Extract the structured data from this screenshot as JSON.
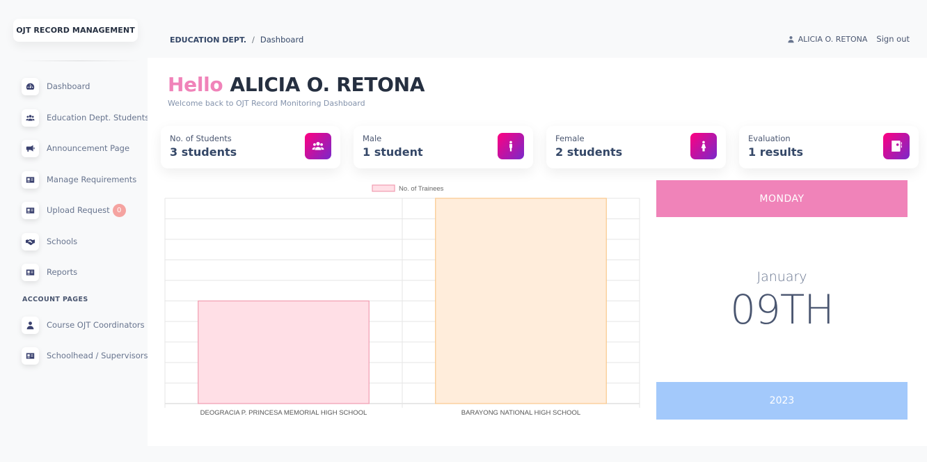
{
  "sidebar": {
    "brand": "OJT RECORD MANAGEMENT",
    "items": [
      {
        "label": "Dashboard",
        "icon": "dashboard-icon"
      },
      {
        "label": "Education Dept. Students",
        "icon": "users-icon"
      },
      {
        "label": "Announcement Page",
        "icon": "megaphone-icon"
      },
      {
        "label": "Manage Requirements",
        "icon": "id-card-icon"
      },
      {
        "label": "Upload Request",
        "icon": "id-card-icon",
        "badge": "0"
      },
      {
        "label": "Schools",
        "icon": "handshake-icon"
      },
      {
        "label": "Reports",
        "icon": "id-card-icon"
      }
    ],
    "section_title": "ACCOUNT PAGES",
    "account_items": [
      {
        "label": "Course OJT Coordinators",
        "icon": "user-icon"
      },
      {
        "label": "Schoolhead / Supervisors",
        "icon": "id-card-icon"
      }
    ]
  },
  "topbar": {
    "breadcrumb_parent": "EDUCATION DEPT.",
    "breadcrumb_sep": "/",
    "breadcrumb_current": "Dashboard",
    "user_name": "ALICIA O. RETONA",
    "signout": "Sign out"
  },
  "header": {
    "hello": "Hello",
    "name": "ALICIA O. RETONA",
    "subtitle": "Welcome back to OJT Record Monitoring Dashboard"
  },
  "stats": [
    {
      "label": "No. of Students",
      "value": "3 students",
      "icon": "users-icon"
    },
    {
      "label": "Male",
      "value": "1 student",
      "icon": "male-icon"
    },
    {
      "label": "Female",
      "value": "2 students",
      "icon": "female-icon"
    },
    {
      "label": "Evaluation",
      "value": "1 results",
      "icon": "report-card-icon"
    }
  ],
  "calendar": {
    "day": "MONDAY",
    "month": "January",
    "date": "09TH",
    "year": "2023"
  },
  "colors": {
    "accent_pink": "#f083b9",
    "accent_blue": "#a3c9fb",
    "icon_gradient_start": "#7928ca",
    "icon_gradient_end": "#ff0080"
  },
  "chart_data": {
    "type": "bar",
    "categories": [
      "DEOGRACIA P. PRINCESA MEMORIAL HIGH SCHOOL",
      "BARAYONG NATIONAL HIGH SCHOOL"
    ],
    "series": [
      {
        "name": "No. of Trainees",
        "values": [
          1,
          2
        ]
      }
    ],
    "bar_colors": [
      "#ffdfe6",
      "#ffeddb"
    ],
    "bar_borders": [
      "#f19cb0",
      "#f9c88c"
    ],
    "ylim": [
      0,
      2
    ],
    "grid": true,
    "legend": "top"
  }
}
